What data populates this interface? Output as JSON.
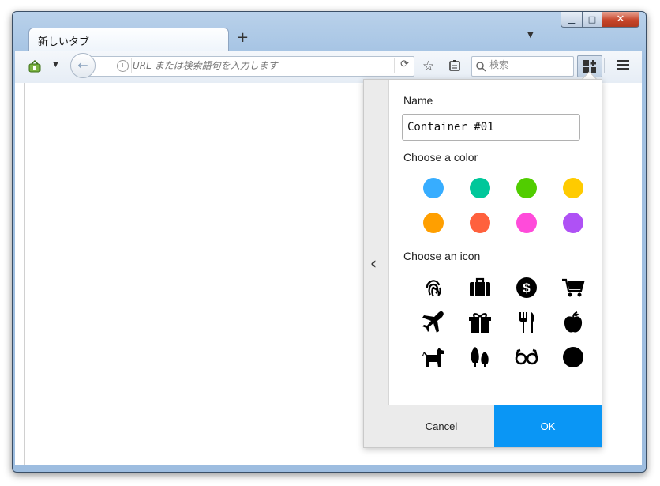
{
  "window": {
    "controls": {
      "minimize": "▁",
      "maximize": "□",
      "close": "✕"
    }
  },
  "tabs": [
    {
      "title": "新しいタブ",
      "active": true
    }
  ],
  "tabbar": {
    "new_tab": "+",
    "list_all": "▼"
  },
  "urlbar": {
    "placeholder": "URL または検索語句を入力します",
    "info": "i"
  },
  "searchbar": {
    "placeholder": "検索"
  },
  "container_panel": {
    "name_label": "Name",
    "name_value": "Container #01",
    "color_label": "Choose a color",
    "colors": [
      {
        "name": "blue",
        "hex": "#37adff"
      },
      {
        "name": "turquoise",
        "hex": "#00c79a"
      },
      {
        "name": "green",
        "hex": "#51cd00"
      },
      {
        "name": "yellow",
        "hex": "#ffcb00"
      },
      {
        "name": "orange",
        "hex": "#ff9f00"
      },
      {
        "name": "red",
        "hex": "#ff613d"
      },
      {
        "name": "pink",
        "hex": "#ff4bda"
      },
      {
        "name": "purple",
        "hex": "#af51f5"
      }
    ],
    "icon_label": "Choose an icon",
    "icons": [
      "fingerprint",
      "briefcase",
      "dollar",
      "cart",
      "vacation",
      "gift",
      "food",
      "fruit",
      "pet",
      "tree",
      "chill",
      "circle"
    ],
    "cancel_label": "Cancel",
    "ok_label": "OK",
    "accent": "#0a96f5"
  }
}
